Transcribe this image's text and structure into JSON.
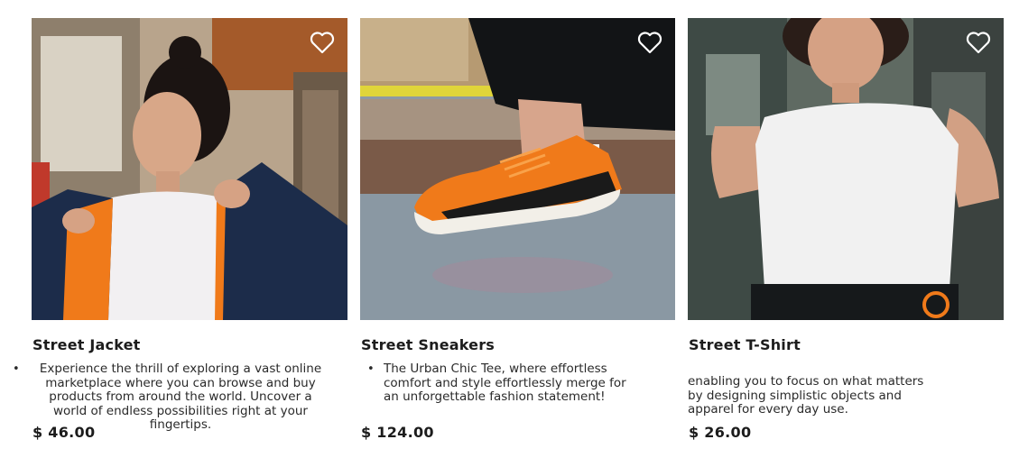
{
  "products": [
    {
      "title": "Street Jacket",
      "description": "Experience the thrill of exploring a vast online marketplace where you can browse and buy products from around the world. Uncover a world of endless possibilities right at your fingertips.",
      "price": "$ 46.00",
      "image_icon": "photo-woman-orange-jacket",
      "favorite_icon": "heart-outline-icon"
    },
    {
      "title": "Street Sneakers",
      "description": "The Urban Chic Tee, where effortless comfort and style effortlessly merge for an unforgettable fashion statement!",
      "price": "$ 124.00",
      "image_icon": "photo-orange-sneaker",
      "favorite_icon": "heart-outline-icon"
    },
    {
      "title": "Street T-Shirt",
      "description": "enabling you to focus on what matters by designing simplistic objects and apparel for every day use.",
      "price": "$ 26.00",
      "image_icon": "photo-woman-white-tshirt",
      "favorite_icon": "heart-outline-icon"
    }
  ],
  "colors": {
    "accent_orange": "#f07a1a",
    "text": "#1c1c1c"
  }
}
